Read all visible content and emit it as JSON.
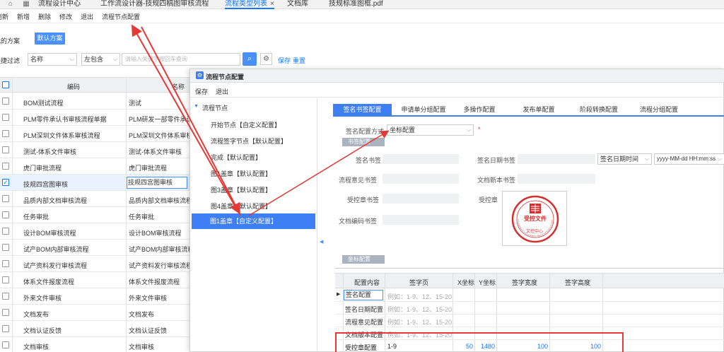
{
  "topbar": {
    "tabs": [
      {
        "label": "流程设计中心"
      },
      {
        "label": "工作流设计器-技规四稿图审核流程"
      },
      {
        "label": "流程类型列表",
        "close": "×"
      },
      {
        "label": "文档库"
      },
      {
        "label": "技规标准图框.pdf"
      }
    ]
  },
  "toolbar": {
    "refresh": "刷新",
    "new": "新增",
    "delete": "删除",
    "edit": "修改",
    "exit": "退出",
    "node_config": "流程节点配置"
  },
  "scheme": {
    "label": "我的方案",
    "default_btn": "默认方案"
  },
  "filter": {
    "label": "快捷过滤",
    "field": "名称",
    "op": "左包含",
    "placeholder": "请输入关键字按回车查询",
    "save": "保存",
    "reset": "重置"
  },
  "grid": {
    "columns": [
      "编码",
      "名称"
    ],
    "rows": [
      {
        "code": "BOM测试流程",
        "name": "测试",
        "checked": false
      },
      {
        "code": "PLM零件承认书审核流程单据",
        "name": "PLM研发一部零件承认",
        "checked": false
      },
      {
        "code": "PLM深圳文件体系审核流程",
        "name": "PLM深圳文件体系审核",
        "checked": false
      },
      {
        "code": "测试-体系文件审核",
        "name": "测试-体系文件审核",
        "checked": false
      },
      {
        "code": "虎门审批流程",
        "name": "虎门审批流程",
        "checked": false
      },
      {
        "code": "技规四宫图审核",
        "name": "技规四宫图审核",
        "checked": true
      },
      {
        "code": "品质内部文档审核流程",
        "name": "品质内部文档审核流程",
        "checked": false
      },
      {
        "code": "任务审批",
        "name": "任务审批",
        "checked": false
      },
      {
        "code": "设计BOM审核流程",
        "name": "设计BOM审核流程",
        "checked": false
      },
      {
        "code": "试产BOM内部审核流程",
        "name": "试产BOM内部审核流程",
        "checked": false
      },
      {
        "code": "试产资料发行审核流程",
        "name": "试产资料发行审核流程",
        "checked": false
      },
      {
        "code": "体系文件报废流程",
        "name": "体系文件报废流程",
        "checked": false
      },
      {
        "code": "外来文件审核",
        "name": "外来文件审核",
        "checked": false
      },
      {
        "code": "文档发布",
        "name": "文档发布",
        "checked": false
      },
      {
        "code": "文档认证反馈",
        "name": "文档认证反馈",
        "checked": false
      },
      {
        "code": "文档审核",
        "name": "文档审核",
        "checked": false
      }
    ]
  },
  "dialog": {
    "title": "流程节点配置",
    "menu": {
      "save": "保存",
      "exit": "退出"
    },
    "tree": {
      "root": "流程节点",
      "nodes": [
        "开始节点【自定义配置】",
        "流程签字节点【默认配置】",
        "完成【默认配置】",
        "图1盖章【默认配置】",
        "图3盖章【默认配置】",
        "图4盖章【默认配置】",
        "图1盖章【自定义配置】"
      ]
    },
    "tabs": [
      "签名书签配置",
      "申请单分组配置",
      "多操作配置",
      "发布单配置",
      "阶段转换配置",
      "流程分组配置"
    ],
    "sign_mode_label": "签名配置方式",
    "sign_mode_value": "坐标配置",
    "required_mark": "*",
    "section1": "书签配置",
    "fields": {
      "sign_bookmark": "签名书签",
      "sign_date_bookmark": "签名日期书签",
      "date_type": "签名日期时间",
      "date_format": "yyyy-MM-dd HH:mm:ss",
      "flow_opinion": "流程意见书签",
      "doc_version": "文档新本书签",
      "control_stamp_bm": "受控章书签",
      "control_stamp": "受控章",
      "doc_code_bm": "文档编码书签"
    },
    "seal": {
      "main": "受控文件",
      "sub": "文控中心"
    },
    "section2": "坐标配置",
    "table": {
      "columns": [
        "配置内容",
        "签字页",
        "X坐标",
        "Y坐标",
        "签字宽度",
        "签字高度"
      ],
      "rows": [
        {
          "content": "签名配置",
          "page": "例如：1-9、12、15-20",
          "x": "",
          "y": "",
          "w": "",
          "h": "",
          "placeholder": true
        },
        {
          "content": "签名日期配置",
          "page": "例如：1-9、12、15-20",
          "x": "",
          "y": "",
          "w": "",
          "h": "",
          "placeholder": true
        },
        {
          "content": "流程意见配置",
          "page": "例如：1-9、12、15-20",
          "x": "",
          "y": "",
          "w": "",
          "h": "",
          "placeholder": true
        },
        {
          "content": "文档版本配置",
          "page": "例如：1-9、12、15-20",
          "x": "",
          "y": "",
          "w": "",
          "h": "",
          "placeholder": true
        },
        {
          "content": "受控章配置",
          "page": "1-9",
          "x": "50",
          "y": "1480",
          "w": "100",
          "h": "100",
          "placeholder": false
        }
      ]
    }
  },
  "colors": {
    "accent": "#3f7ff5",
    "highlight": "#e53935"
  }
}
